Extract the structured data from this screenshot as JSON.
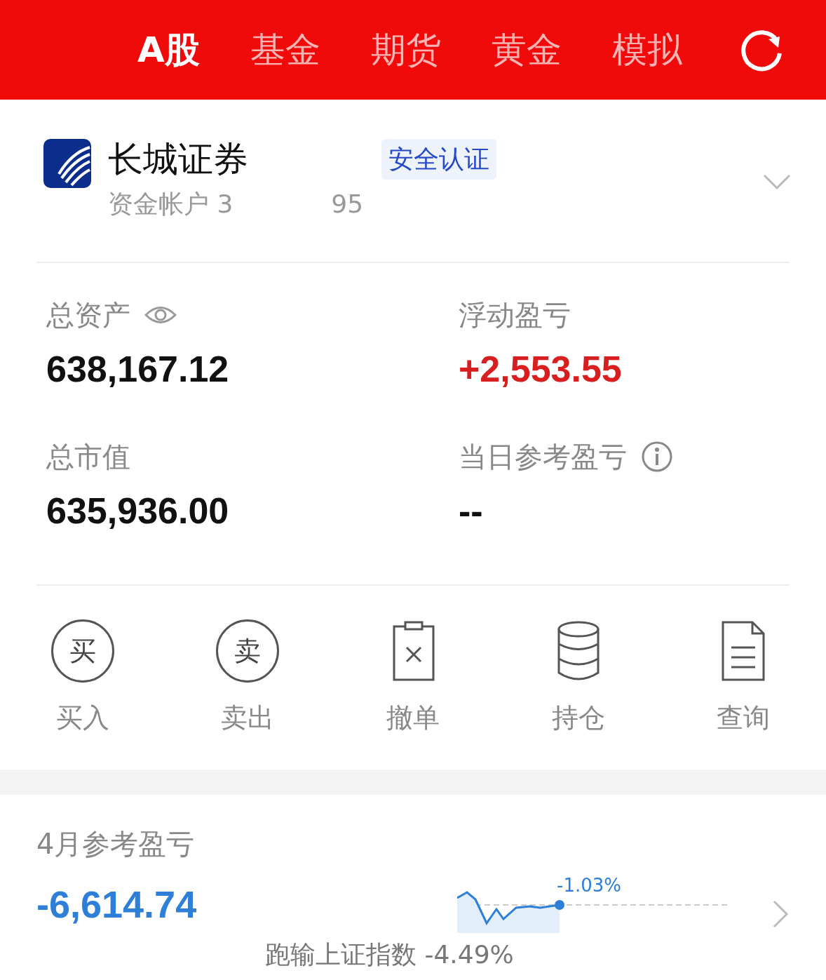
{
  "tabs": [
    {
      "label": "A股",
      "selected": true
    },
    {
      "label": "基金",
      "selected": false
    },
    {
      "label": "期货",
      "selected": false
    },
    {
      "label": "黄金",
      "selected": false
    },
    {
      "label": "模拟",
      "selected": false
    }
  ],
  "account": {
    "broker": "长城证券",
    "badge": "安全认证",
    "account_label": "资金帐户 3",
    "account_tail": "95"
  },
  "summary": [
    {
      "label": "总资产",
      "value": "638,167.12"
    },
    {
      "label": "浮动盈亏",
      "value": "+2,553.55"
    },
    {
      "label": "总市值",
      "value": "635,936.00"
    },
    {
      "label": "当日参考盈亏",
      "value": "--"
    }
  ],
  "actions": [
    {
      "kind": "circle",
      "glyph": "买",
      "label": "买入"
    },
    {
      "kind": "circle",
      "glyph": "卖",
      "label": "卖出"
    },
    {
      "kind": "cancel",
      "label": "撤单"
    },
    {
      "kind": "stack",
      "label": "持仓"
    },
    {
      "kind": "doc",
      "label": "查询"
    }
  ],
  "monthly": {
    "title": "4月参考盈亏",
    "value": "-6,614.74",
    "change": "-1.03%",
    "compare": "跑输上证指数 -4.49%"
  }
}
